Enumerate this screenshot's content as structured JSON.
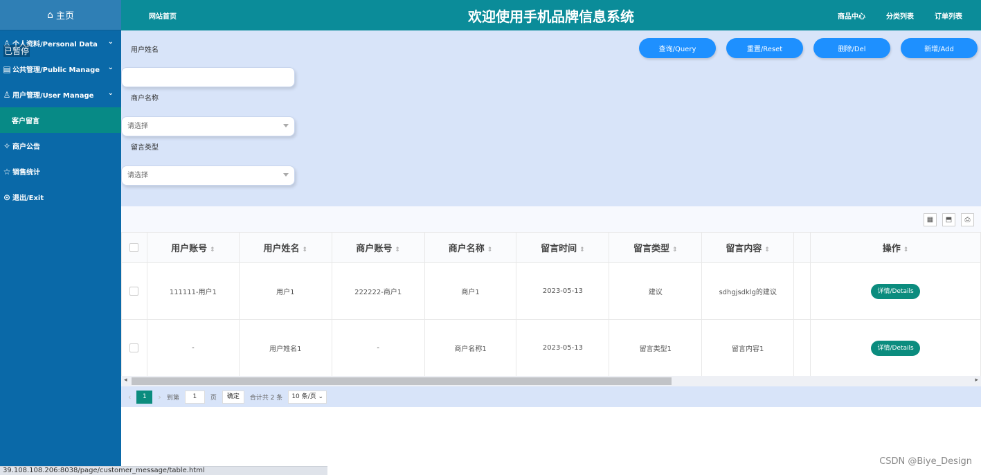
{
  "sidebar": {
    "home": "主页",
    "paused": "已暂停",
    "items": [
      {
        "label": "个人资料/Personal Data",
        "icon": "person-card-icon"
      },
      {
        "label": "公共管理/Public Manage",
        "icon": "board-icon"
      },
      {
        "label": "用户管理/User Manage",
        "icon": "user-icon"
      }
    ],
    "sub_item": "客户留言",
    "items2": [
      {
        "label": "商户公告",
        "icon": "handshake-icon"
      },
      {
        "label": "销售统计",
        "icon": "chart-icon"
      },
      {
        "label": "退出/Exit",
        "icon": "exit-icon"
      }
    ]
  },
  "header": {
    "site_link": "网站首页",
    "title": "欢迎使用手机品牌信息系统",
    "nav": [
      "商品中心",
      "分类列表",
      "订单列表"
    ]
  },
  "search": {
    "label_name": "用户姓名",
    "label_merchant": "商户名称",
    "label_type": "留言类型",
    "select_placeholder": "请选择",
    "buttons": [
      "查询/Query",
      "重置/Reset",
      "删除/Del",
      "新增/Add"
    ]
  },
  "table": {
    "headers": [
      "用户账号",
      "用户姓名",
      "商户账号",
      "商户名称",
      "留言时间",
      "留言类型",
      "留言内容",
      "操作"
    ],
    "rows": [
      [
        "111111-用户1",
        "用户1",
        "222222-商户1",
        "商户1",
        "2023-05-13",
        "建议",
        "sdhgjsdklg的建议"
      ],
      [
        "-",
        "用户姓名1",
        "-",
        "商户名称1",
        "2023-05-13",
        "留言类型1",
        "留言内容1"
      ]
    ],
    "details_label": "详情/Details"
  },
  "pager": {
    "current": "1",
    "goto_label": "到第",
    "goto_value": "1",
    "page_label": "页",
    "confirm": "确定",
    "total": "合计共 2 条",
    "page_size": "10 条/页"
  },
  "status_url": "39.108.108.206:8038/page/customer_message/table.html",
  "watermark": "CSDN @Biye_Design",
  "colors": {
    "sidebar": "#0a69a8",
    "header": "#0b8c99",
    "button": "#1e90ff",
    "accent": "#0b8c7e"
  }
}
